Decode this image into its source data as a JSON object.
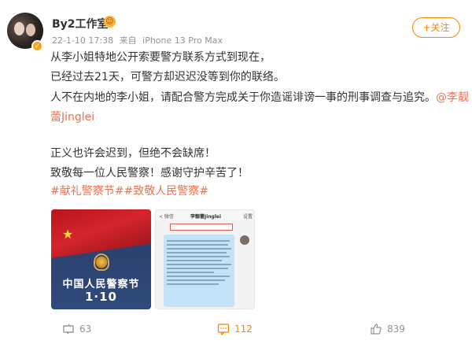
{
  "post": {
    "author": "By2工作室",
    "follow_label": "+关注",
    "timestamp": "22-1-10 17:38",
    "source_prefix": "来自",
    "source": "iPhone 13 Pro Max",
    "lines": [
      "从李小姐特地公开索要警方联系方式到现在，",
      "已经过去21天，可警方却迟迟没等到你的联络。",
      "人不在内地的李小姐，请配合警方完成关于你造谣诽谤一事的刑事调查与追究。"
    ],
    "mention_part1": "@李靓",
    "mention_part2": "蕾Jinglei",
    "lines2": [
      "正义也许会迟到，但绝不会缺席！",
      "致敬每一位人民警察！感谢守护辛苦了！"
    ],
    "hashtags": "#献礼警察节##致敬人民警察#"
  },
  "image1": {
    "title": "中国人民警察节",
    "date": "1·10"
  },
  "image2": {
    "back_label": "< 微信",
    "contact": "李靓蕾Jinglei",
    "more_label": "设置"
  },
  "actions": {
    "repost_count": "63",
    "comment_count": "112",
    "like_count": "839"
  },
  "colors": {
    "accent": "#ff8200",
    "link": "#eb7350",
    "meta": "#939393"
  }
}
